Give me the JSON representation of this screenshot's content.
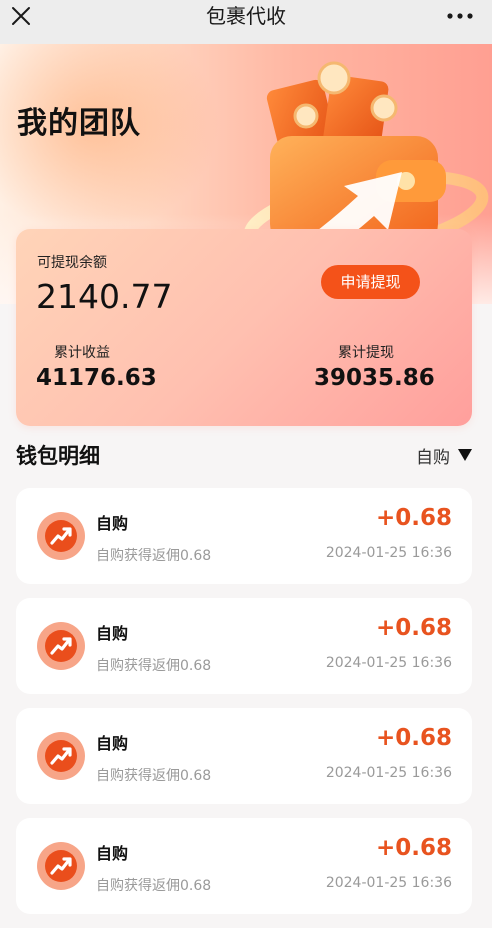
{
  "topbar": {
    "title": "包裹代收",
    "close_icon": "close-icon",
    "more_icon": "more-icon"
  },
  "hero": {
    "title": "我的团队",
    "illustration": "wallet-arrow-illustration"
  },
  "balance_card": {
    "balance_label": "可提现余额",
    "balance_value": "2140.77",
    "withdraw_button": "申请提现",
    "income_label": "累计收益",
    "income_value": "41176.63",
    "withdrawn_label": "累计提现",
    "withdrawn_value": "39035.86"
  },
  "wallet_detail": {
    "title": "钱包明细",
    "filter": "自购",
    "filter_icon": "caret-down-icon"
  },
  "records": [
    {
      "name": "自购",
      "desc": "自购获得返佣0.68",
      "amount": "+0.68",
      "time": "2024-01-25 16:36"
    },
    {
      "name": "自购",
      "desc": "自购获得返佣0.68",
      "amount": "+0.68",
      "time": "2024-01-25 16:36"
    },
    {
      "name": "自购",
      "desc": "自购获得返佣0.68",
      "amount": "+0.68",
      "time": "2024-01-25 16:36"
    },
    {
      "name": "自购",
      "desc": "自购获得返佣0.68",
      "amount": "+0.68",
      "time": "2024-01-25 16:36"
    }
  ],
  "colors": {
    "accent": "#f45219",
    "amount": "#e8531f",
    "icon_bg": "#f7a588",
    "icon_fg": "#ea4e1c"
  }
}
